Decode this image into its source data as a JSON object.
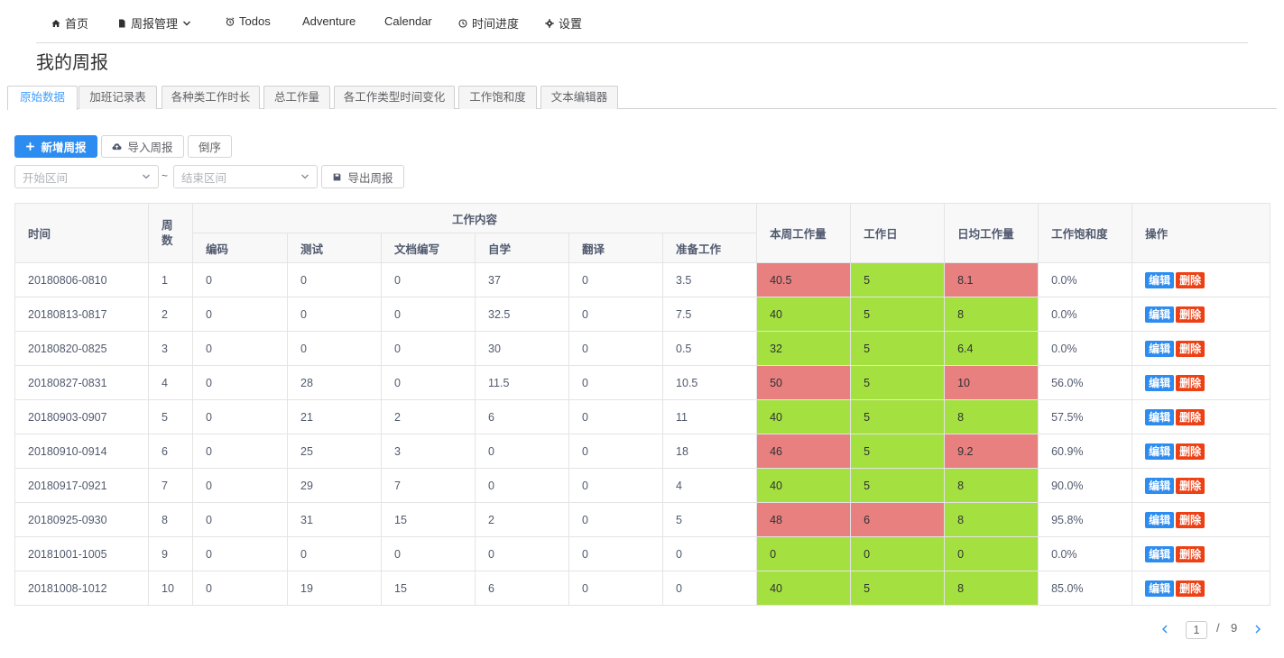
{
  "nav": {
    "items": [
      {
        "label": "首页",
        "icon": "home-icon"
      },
      {
        "label": "周报管理",
        "icon": "document-icon"
      },
      {
        "label": "Todos",
        "icon": "alarm-clock-icon"
      },
      {
        "label": "Adventure"
      },
      {
        "label": "Calendar"
      },
      {
        "label": "时间进度",
        "icon": "clock-icon"
      },
      {
        "label": "设置",
        "icon": "gear-icon"
      }
    ]
  },
  "page_title": "我的周报",
  "tabs": [
    "原始数据",
    "加班记录表",
    "各种类工作时长",
    "总工作量",
    "各工作类型时间变化",
    "工作饱和度",
    "文本编辑器"
  ],
  "toolbar": {
    "add_label": "新增周报",
    "import_label": "导入周报",
    "reverse_label": "倒序",
    "start_placeholder": "开始区间",
    "end_placeholder": "结束区间",
    "tilde": "~",
    "export_label": "导出周报"
  },
  "table": {
    "headers": {
      "time": "时间",
      "week": "周数",
      "content": "工作内容",
      "coding": "编码",
      "testing": "测试",
      "docs": "文档编写",
      "self_study": "自学",
      "translation": "翻译",
      "prep": "准备工作",
      "weekly_total": "本周工作量",
      "workdays": "工作日",
      "daily_avg": "日均工作量",
      "saturation": "工作饱和度",
      "actions": "操作"
    },
    "edit_label": "编辑",
    "delete_label": "删除",
    "rows": [
      {
        "time": "20180806-0810",
        "week": "1",
        "coding": "0",
        "testing": "0",
        "docs": "0",
        "self_study": "37",
        "translation": "0",
        "prep": "3.5",
        "total": "40.5",
        "days": "5",
        "avg": "8.1",
        "sat": "0.0%",
        "total_status": "red",
        "days_status": "green",
        "avg_status": "red"
      },
      {
        "time": "20180813-0817",
        "week": "2",
        "coding": "0",
        "testing": "0",
        "docs": "0",
        "self_study": "32.5",
        "translation": "0",
        "prep": "7.5",
        "total": "40",
        "days": "5",
        "avg": "8",
        "sat": "0.0%",
        "total_status": "green",
        "days_status": "green",
        "avg_status": "green"
      },
      {
        "time": "20180820-0825",
        "week": "3",
        "coding": "0",
        "testing": "0",
        "docs": "0",
        "self_study": "30",
        "translation": "0",
        "prep": "0.5",
        "total": "32",
        "days": "5",
        "avg": "6.4",
        "sat": "0.0%",
        "total_status": "green",
        "days_status": "green",
        "avg_status": "green"
      },
      {
        "time": "20180827-0831",
        "week": "4",
        "coding": "0",
        "testing": "28",
        "docs": "0",
        "self_study": "11.5",
        "translation": "0",
        "prep": "10.5",
        "total": "50",
        "days": "5",
        "avg": "10",
        "sat": "56.0%",
        "total_status": "red",
        "days_status": "green",
        "avg_status": "red"
      },
      {
        "time": "20180903-0907",
        "week": "5",
        "coding": "0",
        "testing": "21",
        "docs": "2",
        "self_study": "6",
        "translation": "0",
        "prep": "11",
        "total": "40",
        "days": "5",
        "avg": "8",
        "sat": "57.5%",
        "total_status": "green",
        "days_status": "green",
        "avg_status": "green"
      },
      {
        "time": "20180910-0914",
        "week": "6",
        "coding": "0",
        "testing": "25",
        "docs": "3",
        "self_study": "0",
        "translation": "0",
        "prep": "18",
        "total": "46",
        "days": "5",
        "avg": "9.2",
        "sat": "60.9%",
        "total_status": "red",
        "days_status": "green",
        "avg_status": "red"
      },
      {
        "time": "20180917-0921",
        "week": "7",
        "coding": "0",
        "testing": "29",
        "docs": "7",
        "self_study": "0",
        "translation": "0",
        "prep": "4",
        "total": "40",
        "days": "5",
        "avg": "8",
        "sat": "90.0%",
        "total_status": "green",
        "days_status": "green",
        "avg_status": "green"
      },
      {
        "time": "20180925-0930",
        "week": "8",
        "coding": "0",
        "testing": "31",
        "docs": "15",
        "self_study": "2",
        "translation": "0",
        "prep": "5",
        "total": "48",
        "days": "6",
        "avg": "8",
        "sat": "95.8%",
        "total_status": "red",
        "days_status": "red",
        "avg_status": "green"
      },
      {
        "time": "20181001-1005",
        "week": "9",
        "coding": "0",
        "testing": "0",
        "docs": "0",
        "self_study": "0",
        "translation": "0",
        "prep": "0",
        "total": "0",
        "days": "0",
        "avg": "0",
        "sat": "0.0%",
        "total_status": "green",
        "days_status": "green",
        "avg_status": "green"
      },
      {
        "time": "20181008-1012",
        "week": "10",
        "coding": "0",
        "testing": "19",
        "docs": "15",
        "self_study": "6",
        "translation": "0",
        "prep": "0",
        "total": "40",
        "days": "5",
        "avg": "8",
        "sat": "85.0%",
        "total_status": "green",
        "days_status": "green",
        "avg_status": "green"
      }
    ]
  },
  "pagination": {
    "current": "1",
    "separator": "/",
    "total": "9"
  },
  "colors": {
    "primary": "#2d8cf0",
    "danger": "#ed4014",
    "over": "#e88080",
    "ok": "#a4e140"
  }
}
